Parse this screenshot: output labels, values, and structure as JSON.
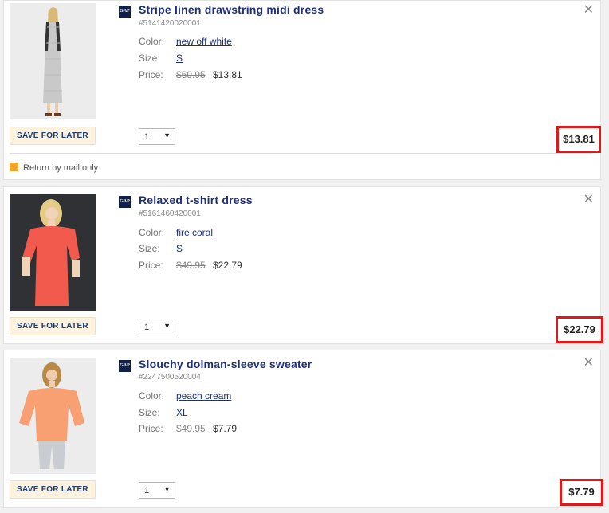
{
  "items": [
    {
      "title": "Stripe linen drawstring midi dress",
      "sku": "#5141420020001",
      "color_label": "Color:",
      "color_value": "new off white",
      "size_label": "Size:",
      "size_value": "S",
      "price_label": "Price:",
      "price_original": "$69.95",
      "price_sale": "$13.81",
      "qty": "1",
      "save_label": "SAVE FOR LATER",
      "total": "$13.81",
      "return_note": "Return by mail only",
      "brand": "GAP"
    },
    {
      "title": "Relaxed t-shirt dress",
      "sku": "#5161460420001",
      "color_label": "Color:",
      "color_value": "fire coral",
      "size_label": "Size:",
      "size_value": "S",
      "price_label": "Price:",
      "price_original": "$49.95",
      "price_sale": "$22.79",
      "qty": "1",
      "save_label": "SAVE FOR LATER",
      "total": "$22.79",
      "brand": "GAP"
    },
    {
      "title": "Slouchy dolman-sleeve sweater",
      "sku": "#2247500520004",
      "color_label": "Color:",
      "color_value": "peach cream",
      "size_label": "Size:",
      "size_value": "XL",
      "price_label": "Price:",
      "price_original": "$49.95",
      "price_sale": "$7.79",
      "qty": "1",
      "save_label": "SAVE FOR LATER",
      "total": "$7.79",
      "brand": "GAP"
    }
  ],
  "icons": {
    "close": "close-icon",
    "caret": "chevron-down-icon",
    "mail": "return-by-mail-icon",
    "brand": "gap-logo-icon"
  },
  "colors": {
    "title": "#1d2f7a",
    "highlight": "#e01818",
    "save_button_bg": "#fbf3df"
  }
}
